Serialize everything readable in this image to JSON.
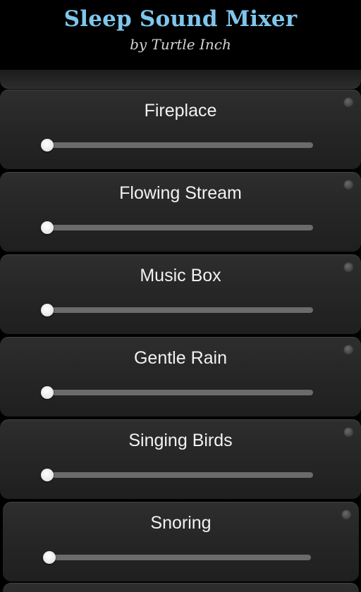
{
  "header": {
    "title": "Sleep Sound Mixer",
    "subtitle": "by Turtle Inch"
  },
  "sounds": [
    {
      "label": "Fireplace",
      "volume": 0
    },
    {
      "label": "Flowing Stream",
      "volume": 0
    },
    {
      "label": "Music Box",
      "volume": 0
    },
    {
      "label": "Gentle Rain",
      "volume": 0
    },
    {
      "label": "Singing Birds",
      "volume": 0
    },
    {
      "label": "Snoring",
      "volume": 0
    }
  ],
  "colors": {
    "title": "#7fc6ec",
    "subtitle": "#d4d4d4",
    "background": "#000000"
  }
}
